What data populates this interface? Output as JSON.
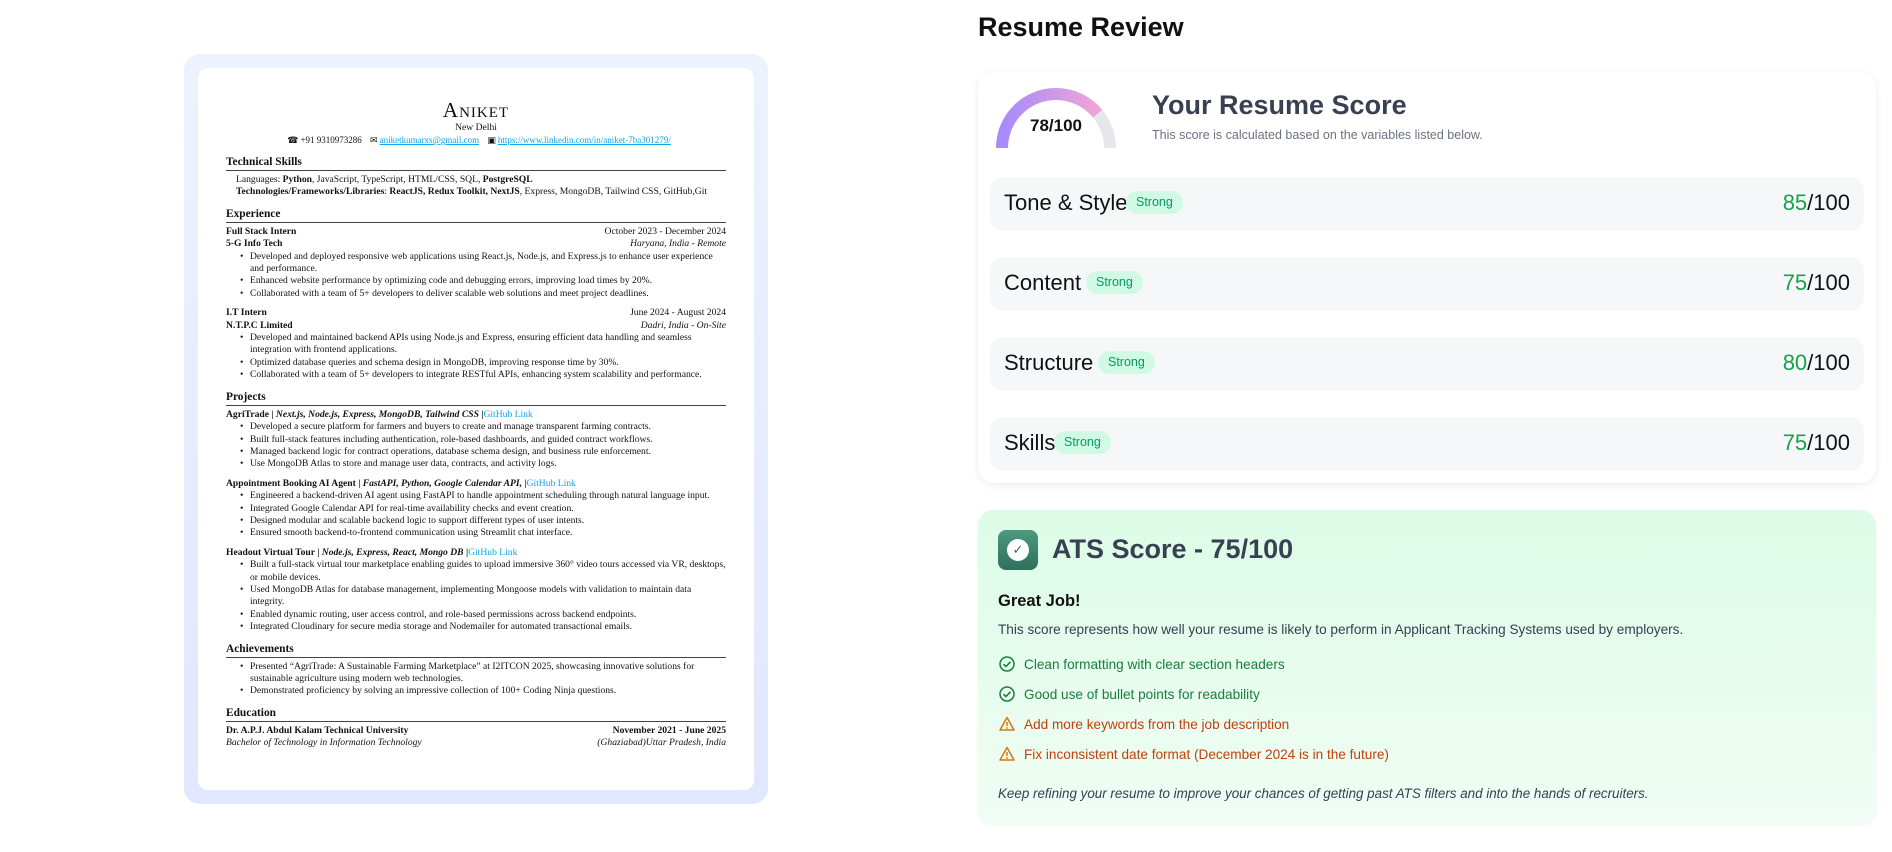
{
  "resume": {
    "name": "Aniket",
    "location": "New Delhi",
    "phone": "+91 9310973286",
    "email": "aniketkumarxs@gmail.com",
    "linkedin": "https://www.linkedin.com/in/aniket-7ba301279/",
    "sections": {
      "skills": "Technical Skills",
      "experience": "Experience",
      "projects": "Projects",
      "achievements": "Achievements",
      "education": "Education"
    },
    "skills": {
      "languages_label": "Languages",
      "languages_bold": "Python",
      "languages_rest": ", JavaScript, TypeScript, HTML/CSS, SQL, ",
      "languages_bold2": "PostgreSQL",
      "tech_label": "Technologies/Frameworks/Libraries",
      "tech_bold": "ReactJS, Redux Toolkit, NextJS",
      "tech_rest": ", Express, MongoDB, Tailwind CSS, GitHub,Git"
    },
    "experience": [
      {
        "role": "Full Stack Intern",
        "dates": "October 2023 - December 2024",
        "company": "5-G Info Tech",
        "place": "Haryana, India - Remote",
        "bullets": [
          "Developed and deployed responsive web applications using React.js, Node.js, and Express.js to enhance user experience and performance.",
          "Enhanced website performance by optimizing code and debugging errors, improving load times by 20%.",
          "Collaborated with a team of 5+ developers to deliver scalable web solutions and meet project deadlines."
        ]
      },
      {
        "role": "I.T Intern",
        "dates": "June 2024 - August 2024",
        "company": "N.T.P.C Limited",
        "place": "Dadri, India - On-Site",
        "bullets": [
          "Developed and maintained backend APIs using Node.js and Express, ensuring efficient data handling and seamless integration with frontend applications.",
          "Optimized database queries and schema design in MongoDB, improving response time by 30%.",
          "Collaborated with a team of 5+ developers to integrate RESTful APIs, enhancing system scalability and performance."
        ]
      }
    ],
    "projects": [
      {
        "name": "AgriTrade",
        "tech": "Next.js, Node.js, Express, MongoDB, Tailwind CSS",
        "link": "GitHub Link",
        "bullets": [
          "Developed a secure platform for farmers and buyers to create and manage transparent farming contracts.",
          "Built full-stack features including authentication, role-based dashboards, and guided contract workflows.",
          "Managed backend logic for contract operations, database schema design, and business rule enforcement.",
          "Use MongoDB Atlas to store and manage user data, contracts, and activity logs."
        ]
      },
      {
        "name": "Appointment Booking AI Agent",
        "tech": "FastAPI, Python, Google Calendar API,",
        "link": "GitHub Link",
        "bullets": [
          "Engineered a backend-driven AI agent using FastAPI to handle appointment scheduling through natural language input.",
          "Integrated Google Calendar API for real-time availability checks and event creation.",
          "Designed modular and scalable backend logic to support different types of user intents.",
          "Ensured smooth backend-to-frontend communication using Streamlit chat interface."
        ]
      },
      {
        "name": "Headout Virtual Tour",
        "tech": "Node.js, Express, React, Mongo DB",
        "link": "GitHub Link",
        "bullets": [
          "Built a full-stack virtual tour marketplace enabling guides to upload immersive 360° video tours accessed via VR, desktops, or mobile devices.",
          "Used MongoDB Atlas for database management, implementing Mongoose models with validation to maintain data integrity.",
          "Enabled dynamic routing, user access control, and role-based permissions across backend endpoints.",
          "Integrated Cloudinary for secure media storage and Nodemailer for automated transactional emails."
        ]
      }
    ],
    "achievements": [
      "Presented “AgriTrade: A Sustainable Farming Marketplace” at I2ITCON 2025, showcasing innovative solutions for sustainable agriculture using modern web technologies.",
      "Demonstrated proficiency by solving an impressive collection of 100+ Coding Ninja questions."
    ],
    "education": {
      "school": "Dr. A.P.J. Abdul Kalam Technical University",
      "dates": "November 2021 - June 2025",
      "degree": "Bachelor of Technology in Information Technology",
      "place": "(Ghaziabad)Uttar Pradesh, India"
    }
  },
  "review": {
    "title": "Resume Review",
    "gauge_label": "78/100",
    "overall_score": 78,
    "score_heading": "Your Resume Score",
    "score_sub": "This score is calculated based on the variables listed below.",
    "categories": [
      {
        "name": "Tone & Style",
        "badge": "Strong",
        "score": "85",
        "suffix": "/100"
      },
      {
        "name": "Content",
        "badge": "Strong",
        "score": "75",
        "suffix": "/100"
      },
      {
        "name": "Structure",
        "badge": "Strong",
        "score": "80",
        "suffix": "/100"
      },
      {
        "name": "Skills",
        "badge": "Strong",
        "score": "75",
        "suffix": "/100"
      }
    ]
  },
  "ats": {
    "title": "ATS Score - 75/100",
    "great": "Great Job!",
    "desc": "This score represents how well your resume is likely to perform in Applicant Tracking Systems used by employers.",
    "items": [
      {
        "text": "Clean formatting with clear section headers",
        "type": "good"
      },
      {
        "text": "Good use of bullet points for readability",
        "type": "good"
      },
      {
        "text": "Add more keywords from the job description",
        "type": "warn"
      },
      {
        "text": "Fix inconsistent date format (December 2024 is in the future)",
        "type": "warn"
      }
    ],
    "footer": "Keep refining your resume to improve your chances of getting past ATS filters and into the hands of recruiters."
  },
  "colors": {
    "accent_green": "#16a34a",
    "warn_orange": "#c2410c",
    "badge_bg": "#d1fae5",
    "gauge_start": "#a78bfa",
    "gauge_end": "#f9a8d4"
  }
}
